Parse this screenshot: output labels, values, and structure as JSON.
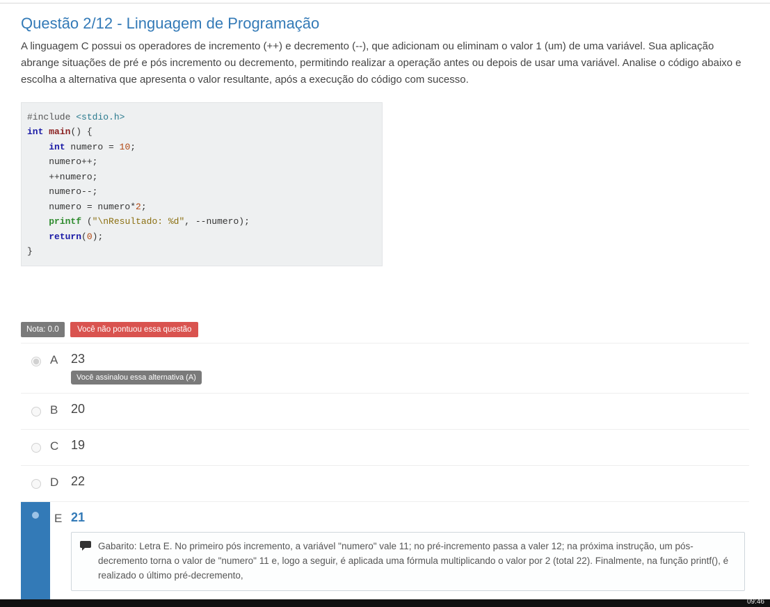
{
  "question": {
    "title": "Questão 2/12 - Linguagem de Programação",
    "prompt": "A linguagem C possui os operadores de incremento (++) e decremento (--), que adicionam ou eliminam o valor 1 (um) de uma variável. Sua aplicação abrange situações de pré e pós incremento ou decremento, permitindo realizar a operação antes ou depois de usar uma variável. Analise o código abaixo e escolha a alternativa que apresenta o valor resultante, após a execução do código com sucesso."
  },
  "code": {
    "pp": "#include",
    "hdr": "<stdio.h>",
    "kw_int1": "int",
    "fn_main": "main",
    "after_main": "() {",
    "l3_kw": "int",
    "l3_rest": " numero = ",
    "l3_num": "10",
    "l4": "    numero++;",
    "l5": "    ++numero;",
    "l6": "    numero--;",
    "l7a": "    numero = numero*",
    "l7_num": "2",
    "l8_call": "printf",
    "l8_open": " (",
    "l8_str": "\"\\nResultado: %d\"",
    "l8_rest": ", --numero);",
    "l9_kw": "return",
    "l9_rest": "(",
    "l9_num": "0",
    "l9_end": ");",
    "l10": "}"
  },
  "score": {
    "nota_label": "Nota: 0.0",
    "fail_label": "Você não pontuou essa questão"
  },
  "answers": {
    "selected_tag": "Você assinalou essa alternativa (A)",
    "A": "23",
    "B": "20",
    "C": "19",
    "D": "22",
    "E": "21",
    "letters": {
      "A": "A",
      "B": "B",
      "C": "C",
      "D": "D",
      "E": "E"
    }
  },
  "gabarito": "Gabarito: Letra E. No primeiro pós incremento, a variável \"numero\" vale 11; no pré-incremento passa a valer 12; na próxima instrução, um pós-decremento torna o valor de \"numero\" 11 e, logo a seguir, é aplicada uma fórmula multiplicando o valor por 2 (total 22). Finalmente, na função printf(), é realizado o último pré-decremento,",
  "taskbar": {
    "time": "09:46"
  }
}
